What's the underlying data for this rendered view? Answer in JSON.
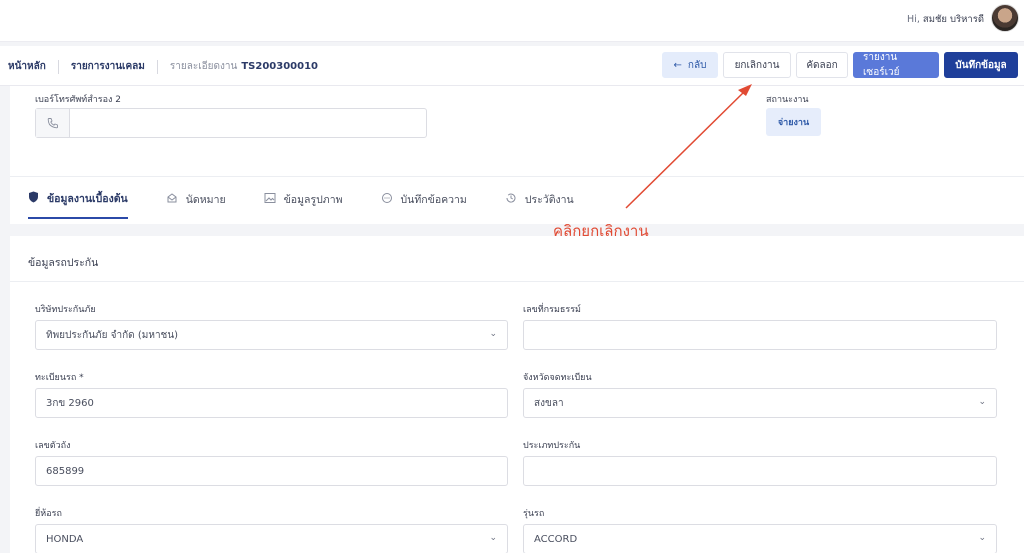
{
  "header": {
    "greeting_prefix": "Hi,",
    "user_name": "สมชัย บริหารดี"
  },
  "breadcrumb": {
    "home": "หน้าหลัก",
    "claims": "รายการงานเคลม",
    "detail_label": "รายละเอียดงาน",
    "job_id": "TS200300010"
  },
  "toolbar": {
    "back_icon": "←",
    "back_label": "กลับ",
    "cancel_label": "ยกเลิกงาน",
    "copy_label": "คัดลอก",
    "survey_report_label": "รายงานเซอร์เวย์",
    "save_label": "บันทึกข้อมูล"
  },
  "contact": {
    "phone2_label": "เบอร์โทรศัพท์สำรอง 2",
    "phone2_value": "",
    "status_label": "สถานะงาน",
    "status_value": "จ่ายงาน"
  },
  "tabs": [
    {
      "label": "ข้อมูลงานเบื้องต้น",
      "icon": "shield-icon",
      "active": true
    },
    {
      "label": "นัดหมาย",
      "icon": "calendar-icon",
      "active": false
    },
    {
      "label": "ข้อมูลรูปภาพ",
      "icon": "image-icon",
      "active": false
    },
    {
      "label": "บันทึกข้อความ",
      "icon": "chat-icon",
      "active": false
    },
    {
      "label": "ประวัติงาน",
      "icon": "history-icon",
      "active": false
    }
  ],
  "annotation": {
    "text": "คลิกยกเลิกงาน",
    "color": "#e14a33"
  },
  "vehicle": {
    "section_title": "ข้อมูลรถประกัน",
    "insurer_label": "บริษัทประกันภัย",
    "insurer_value": "ทิพยประกันภัย จำกัด (มหาชน)",
    "policy_label": "เลขที่กรมธรรม์",
    "policy_value": "",
    "plate_label": "ทะเบียนรถ *",
    "plate_value": "3กข 2960",
    "province_label": "จังหวัดจดทะเบียน",
    "province_value": "สงขลา",
    "chassis_label": "เลขตัวถัง",
    "chassis_value": "685899",
    "ins_type_label": "ประเภทประกัน",
    "ins_type_value": "",
    "brand_label": "ยี่ห้อรถ",
    "brand_value": "HONDA",
    "model_label": "รุ่นรถ",
    "model_value": "ACCORD"
  },
  "colors": {
    "primary": "#1f3f9a",
    "secondary": "#5a79d9",
    "back_bg": "#e4ecfb",
    "annotation": "#e14a33"
  }
}
